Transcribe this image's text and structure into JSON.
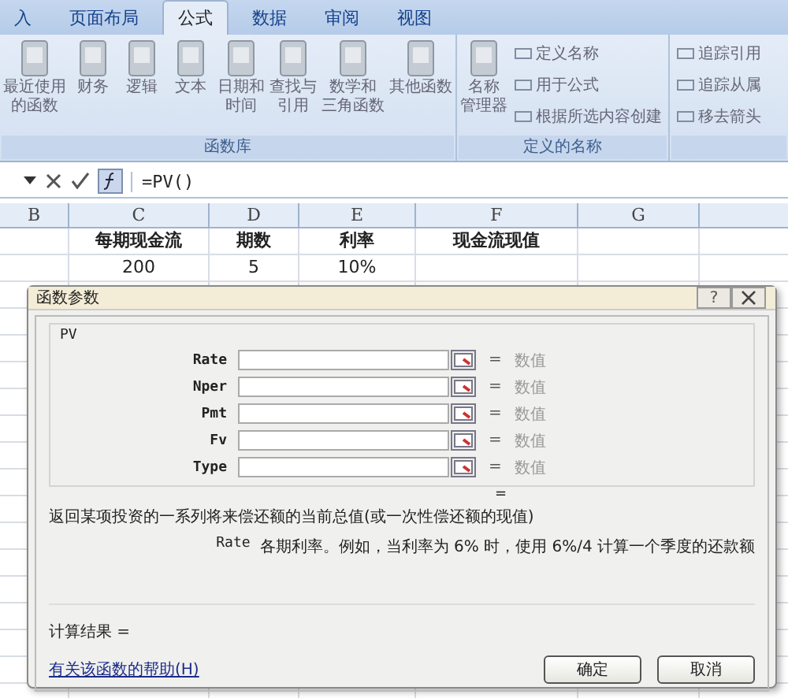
{
  "ribbon": {
    "tabs": [
      {
        "label": "入",
        "selected": false
      },
      {
        "label": "页面布局",
        "selected": false
      },
      {
        "label": "公式",
        "selected": true
      },
      {
        "label": "数据",
        "selected": false
      },
      {
        "label": "审阅",
        "selected": false
      },
      {
        "label": "视图",
        "selected": false
      }
    ],
    "groups": [
      {
        "title": "函数库",
        "buttons": [
          {
            "kind": "large",
            "lines": [
              "最近使用",
              "的函数"
            ]
          },
          {
            "kind": "large",
            "lines": [
              "财务"
            ]
          },
          {
            "kind": "large",
            "lines": [
              "逻辑"
            ]
          },
          {
            "kind": "large",
            "lines": [
              "文本"
            ]
          },
          {
            "kind": "large",
            "lines": [
              "日期和",
              "时间"
            ]
          },
          {
            "kind": "large",
            "lines": [
              "查找与",
              "引用"
            ]
          },
          {
            "kind": "large",
            "lines": [
              "数学和",
              "三角函数"
            ]
          },
          {
            "kind": "large",
            "lines": [
              "其他函数"
            ]
          }
        ]
      },
      {
        "title": "定义的名称",
        "buttons": [
          {
            "kind": "large",
            "lines": [
              "名称",
              "管理器"
            ]
          },
          {
            "kind": "small",
            "lines": [
              "定义名称"
            ]
          },
          {
            "kind": "small",
            "lines": [
              "用于公式"
            ]
          },
          {
            "kind": "small",
            "lines": [
              "根据所选内容创建"
            ]
          }
        ]
      },
      {
        "buttons": [
          {
            "kind": "small",
            "lines": [
              "追踪引用"
            ]
          },
          {
            "kind": "small",
            "lines": [
              "追踪从属"
            ]
          },
          {
            "kind": "small",
            "lines": [
              "移去箭头"
            ]
          }
        ]
      }
    ]
  },
  "formula_bar": {
    "formula": "=PV()"
  },
  "sheet": {
    "columns": [
      "B",
      "C",
      "D",
      "E",
      "F",
      "G"
    ],
    "rows": [
      [
        "",
        "每期现金流",
        "期数",
        "利率",
        "现金流现值",
        ""
      ],
      [
        "",
        "200",
        "5",
        "10%",
        "",
        ""
      ]
    ]
  },
  "dialog": {
    "title": "函数参数",
    "help": "?",
    "function_name": "PV",
    "arguments": [
      {
        "name": "Rate",
        "equals": "=",
        "hint": "数值"
      },
      {
        "name": "Nper",
        "equals": "=",
        "hint": "数值"
      },
      {
        "name": "Pmt",
        "equals": "=",
        "hint": "数值"
      },
      {
        "name": "Fv",
        "equals": "=",
        "hint": "数值"
      },
      {
        "name": "Type",
        "equals": "=",
        "hint": "数值"
      }
    ],
    "result_equals": "=",
    "description": "返回某项投资的一系列将来偿还额的当前总值(或一次性偿还额的现值)",
    "arg_name": "Rate",
    "arg_description": "各期利率。例如，当利率为 6% 时，使用 6%/4 计算一个季度的还款额",
    "result_label": "计算结果 =",
    "help_link": "有关该函数的帮助(H)",
    "buttons": [
      "确定",
      "取消"
    ]
  }
}
